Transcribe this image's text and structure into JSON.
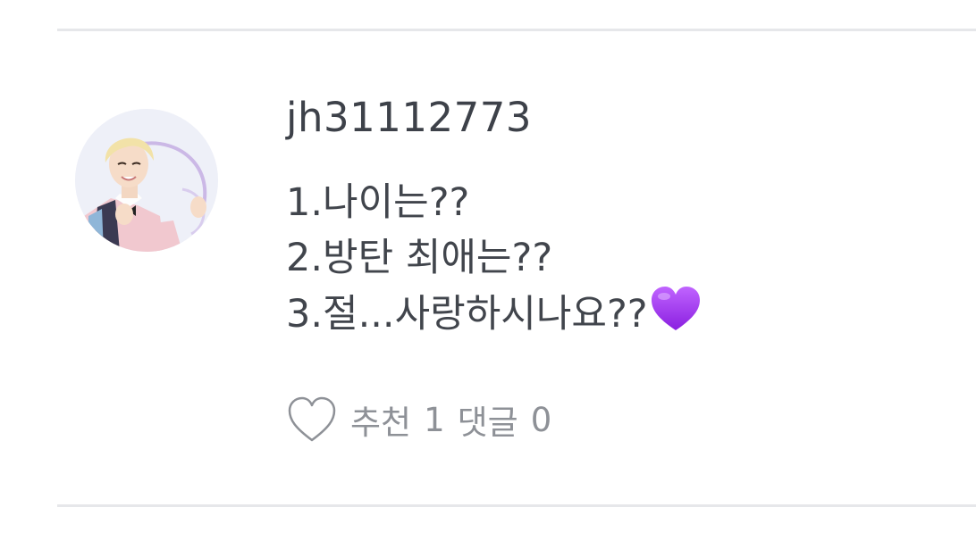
{
  "comment": {
    "username": "jh31112773",
    "lines": [
      "1.나이는??",
      "2.방탄 최애는??",
      "3.절...사랑하시나요??"
    ],
    "trailing_emoji": "purple-heart-emoji"
  },
  "actions": {
    "like_icon": "heart-outline-icon",
    "recommend_label": "추천",
    "recommend_count": "1",
    "reply_label": "댓글",
    "reply_count": "0"
  },
  "colors": {
    "text": "#41454c",
    "muted": "#8e9197",
    "divider": "#e6e7ea",
    "emoji": "#9b30e8"
  }
}
